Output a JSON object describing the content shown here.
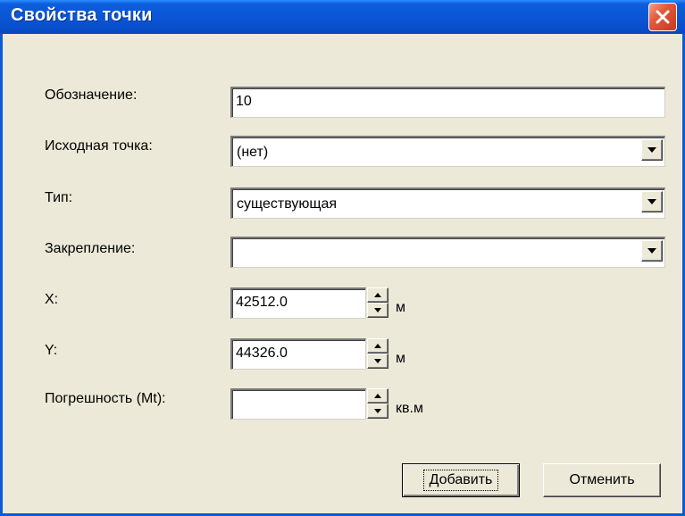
{
  "window": {
    "title": "Свойства точки",
    "close_icon": "close-icon"
  },
  "fields": {
    "designation": {
      "label": "Обозначение:",
      "value": "10"
    },
    "source_point": {
      "label": "Исходная точка:",
      "value": "(нет)"
    },
    "type": {
      "label": "Тип:",
      "value": "существующая"
    },
    "fixing": {
      "label": "Закрепление:",
      "value": ""
    },
    "x": {
      "label": "X:",
      "value": "42512.0",
      "unit": "м"
    },
    "y": {
      "label": "Y:",
      "value": "44326.0",
      "unit": "м"
    },
    "error": {
      "label": "Погрешность (Mt):",
      "value": "",
      "unit": "кв.м"
    }
  },
  "buttons": {
    "add": "Добавить",
    "cancel": "Отменить"
  },
  "colors": {
    "titlebar": "#0a56d4",
    "client": "#ece9d8",
    "close_button": "#e2583a"
  }
}
